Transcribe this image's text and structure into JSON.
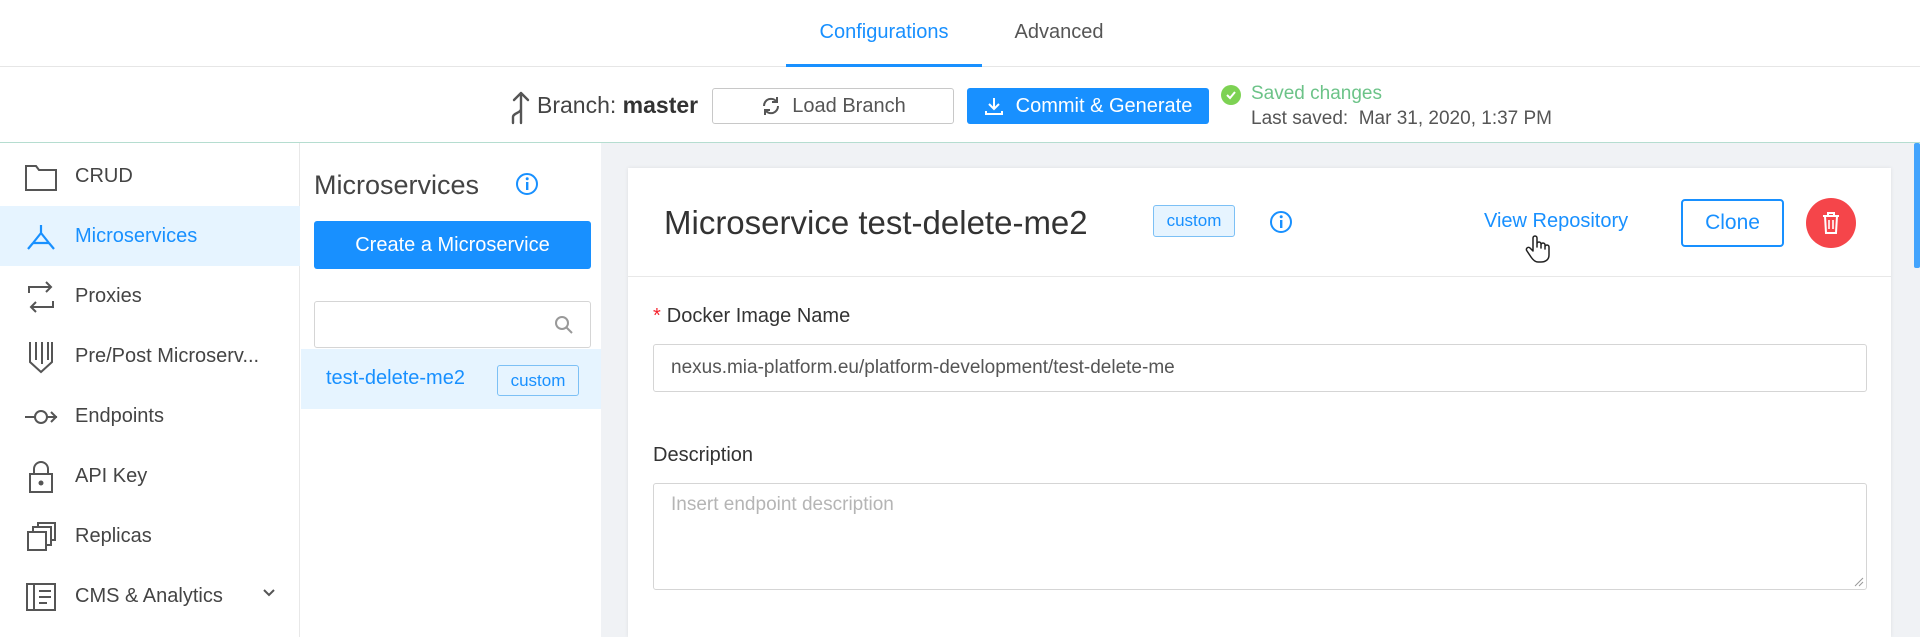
{
  "tabs": [
    {
      "label": "Configurations"
    },
    {
      "label": "Advanced"
    }
  ],
  "branch_bar": {
    "branch_prefix": "Branch:",
    "branch_name": "master",
    "load_label": "Load Branch",
    "commit_label": "Commit & Generate",
    "saved_status": "Saved changes",
    "last_saved_label": "Last saved:",
    "last_saved_value": "Mar 31, 2020, 1:37 PM"
  },
  "sidebar": {
    "items": [
      {
        "label": "CRUD",
        "icon": "folder-icon"
      },
      {
        "label": "Microservices",
        "icon": "microservices-icon"
      },
      {
        "label": "Proxies",
        "icon": "proxies-icon"
      },
      {
        "label": "Pre/Post Microserv...",
        "icon": "pre-post-icon"
      },
      {
        "label": "Endpoints",
        "icon": "endpoints-icon"
      },
      {
        "label": "API Key",
        "icon": "lock-icon"
      },
      {
        "label": "Replicas",
        "icon": "replicas-icon"
      },
      {
        "label": "CMS & Analytics",
        "icon": "cms-icon"
      }
    ]
  },
  "middle": {
    "title": "Microservices",
    "create_label": "Create a Microservice",
    "search_placeholder": "",
    "items": [
      {
        "name": "test-delete-me2",
        "tag": "custom"
      }
    ]
  },
  "detail": {
    "title": "Microservice test-delete-me2",
    "tag": "custom",
    "view_repo_label": "View Repository",
    "clone_label": "Clone",
    "docker_label": "Docker Image Name",
    "docker_required_mark": "*",
    "docker_value": "nexus.mia-platform.eu/platform-development/test-delete-me",
    "description_label": "Description",
    "description_placeholder": "Insert endpoint description"
  },
  "colors": {
    "accent": "#1890ff",
    "danger": "#f5454a",
    "success": "#6cc388"
  }
}
